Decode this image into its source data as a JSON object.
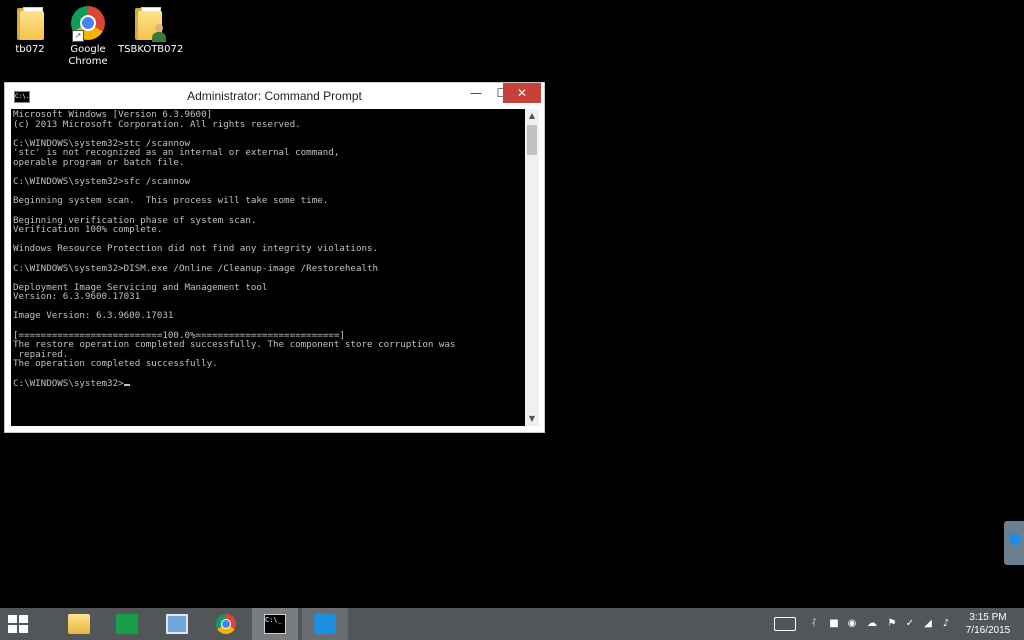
{
  "desktop": {
    "icons": [
      {
        "label": "tb072"
      },
      {
        "label": "Google\nChrome"
      },
      {
        "label": "TSBKOTB072"
      }
    ]
  },
  "window": {
    "title": "Administrator: Command Prompt",
    "icon_text": "C:\\.",
    "buttons": {
      "minimize": "—",
      "maximize": "☐",
      "close": "✕"
    },
    "console_lines": [
      "Microsoft Windows [Version 6.3.9600]",
      "(c) 2013 Microsoft Corporation. All rights reserved.",
      "",
      "C:\\WINDOWS\\system32>stc /scannow",
      "'stc' is not recognized as an internal or external command,",
      "operable program or batch file.",
      "",
      "C:\\WINDOWS\\system32>sfc /scannow",
      "",
      "Beginning system scan.  This process will take some time.",
      "",
      "Beginning verification phase of system scan.",
      "Verification 100% complete.",
      "",
      "Windows Resource Protection did not find any integrity violations.",
      "",
      "C:\\WINDOWS\\system32>DISM.exe /Online /Cleanup-image /Restorehealth",
      "",
      "Deployment Image Servicing and Management tool",
      "Version: 6.3.9600.17031",
      "",
      "Image Version: 6.3.9600.17031",
      "",
      "[==========================100.0%==========================]",
      "The restore operation completed successfully. The component store corruption was",
      " repaired.",
      "The operation completed successfully.",
      "",
      "C:\\WINDOWS\\system32>"
    ]
  },
  "taskbar": {
    "cmd_icon_text": "C:\\_",
    "clock": {
      "time": "3:15 PM",
      "date": "7/16/2015"
    }
  }
}
